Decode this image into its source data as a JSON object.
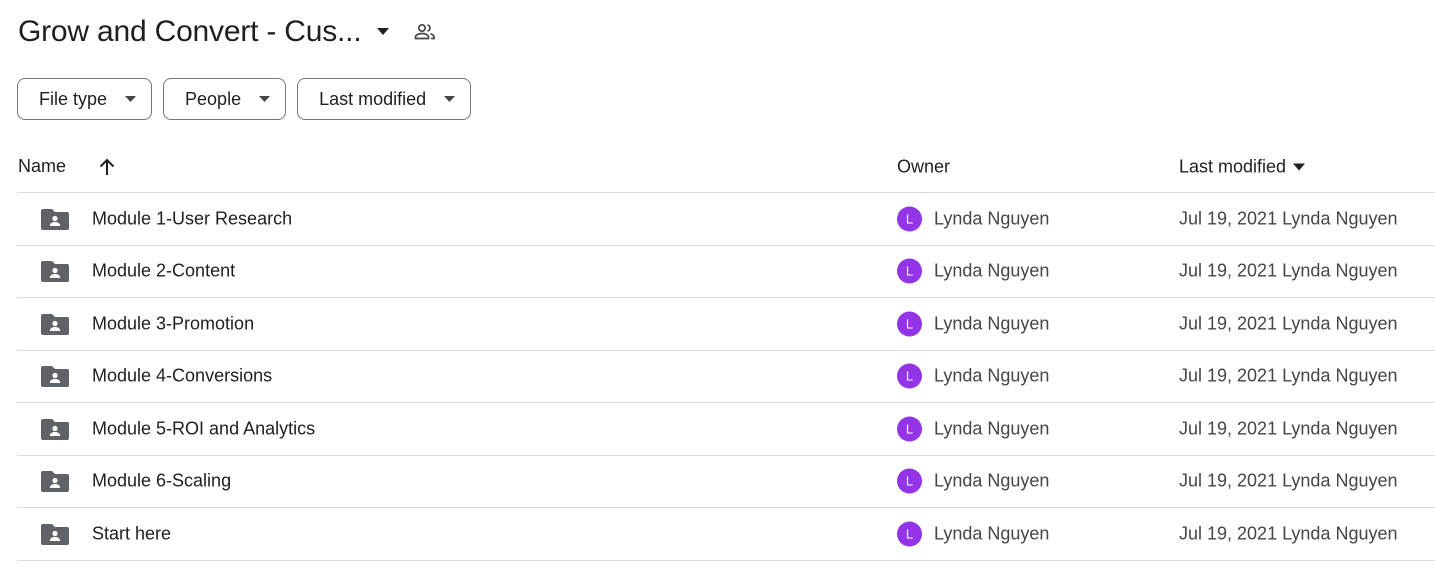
{
  "header": {
    "title": "Grow and Convert - Cus...",
    "title_caret_icon": "arrow-drop-down-icon",
    "shared_icon": "people-outline-icon"
  },
  "filters": [
    {
      "label": "File type"
    },
    {
      "label": "People"
    },
    {
      "label": "Last modified"
    }
  ],
  "table": {
    "columns": {
      "name": "Name",
      "owner": "Owner",
      "last_modified": "Last modified"
    },
    "sort_icon": "arrow-upward-icon",
    "rows": [
      {
        "name": "Module 1-User Research",
        "owner_initial": "L",
        "owner": "Lynda Nguyen",
        "modified": "Jul 19, 2021 Lynda Nguyen"
      },
      {
        "name": "Module 2-Content",
        "owner_initial": "L",
        "owner": "Lynda Nguyen",
        "modified": "Jul 19, 2021 Lynda Nguyen"
      },
      {
        "name": "Module 3-Promotion",
        "owner_initial": "L",
        "owner": "Lynda Nguyen",
        "modified": "Jul 19, 2021 Lynda Nguyen"
      },
      {
        "name": "Module 4-Conversions",
        "owner_initial": "L",
        "owner": "Lynda Nguyen",
        "modified": "Jul 19, 2021 Lynda Nguyen"
      },
      {
        "name": "Module 5-ROI and Analytics",
        "owner_initial": "L",
        "owner": "Lynda Nguyen",
        "modified": "Jul 19, 2021 Lynda Nguyen"
      },
      {
        "name": "Module 6-Scaling",
        "owner_initial": "L",
        "owner": "Lynda Nguyen",
        "modified": "Jul 19, 2021 Lynda Nguyen"
      },
      {
        "name": "Start here",
        "owner_initial": "L",
        "owner": "Lynda Nguyen",
        "modified": "Jul 19, 2021 Lynda Nguyen"
      }
    ]
  },
  "colors": {
    "avatar": "#9334e6",
    "folder_icon": "#5f6368",
    "divider": "#dadce0",
    "chip_border": "#747775"
  }
}
